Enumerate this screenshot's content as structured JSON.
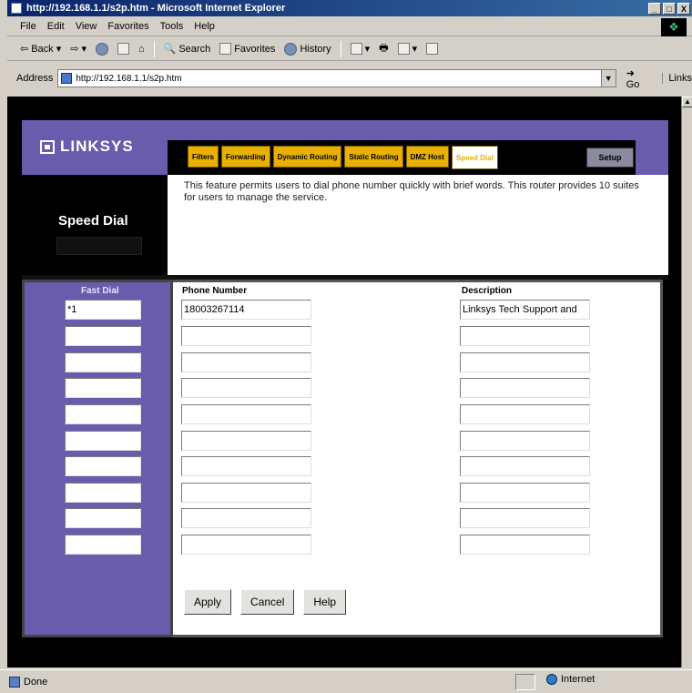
{
  "window": {
    "title": "http://192.168.1.1/s2p.htm - Microsoft Internet Explorer",
    "min": "_",
    "max": "□",
    "close": "X"
  },
  "menu": [
    "File",
    "Edit",
    "View",
    "Favorites",
    "Tools",
    "Help"
  ],
  "toolbar": {
    "back": "Back",
    "search": "Search",
    "favorites": "Favorites",
    "history": "History"
  },
  "address": {
    "label": "Address",
    "url": "http://192.168.1.1/s2p.htm",
    "go": "Go",
    "links": "Links"
  },
  "router": {
    "brand": "LINKSYS",
    "tabs": [
      "Filters",
      "Forwarding",
      "Dynamic Routing",
      "Static Routing",
      "DMZ Host",
      "Speed Dial"
    ],
    "active_tab": "Speed Dial",
    "setup": "Setup",
    "page_title": "Speed Dial",
    "description": "This feature permits users to dial phone number quickly with brief words. This router provides 10 suites for users to manage the service.",
    "columns": {
      "fast_dial": "Fast Dial",
      "phone": "Phone Number",
      "description": "Description"
    },
    "rows": [
      {
        "fast": "*1",
        "phone": "18003267114",
        "desc": "Linksys Tech Support and"
      },
      {
        "fast": "",
        "phone": "",
        "desc": ""
      },
      {
        "fast": "",
        "phone": "",
        "desc": ""
      },
      {
        "fast": "",
        "phone": "",
        "desc": ""
      },
      {
        "fast": "",
        "phone": "",
        "desc": ""
      },
      {
        "fast": "",
        "phone": "",
        "desc": ""
      },
      {
        "fast": "",
        "phone": "",
        "desc": ""
      },
      {
        "fast": "",
        "phone": "",
        "desc": ""
      },
      {
        "fast": "",
        "phone": "",
        "desc": ""
      },
      {
        "fast": "",
        "phone": "",
        "desc": ""
      }
    ],
    "buttons": {
      "apply": "Apply",
      "cancel": "Cancel",
      "help": "Help"
    }
  },
  "status": {
    "text": "Done",
    "zone": "Internet"
  },
  "colors": {
    "purple": "#6a5cad",
    "tab_gold": "#e8b000"
  }
}
